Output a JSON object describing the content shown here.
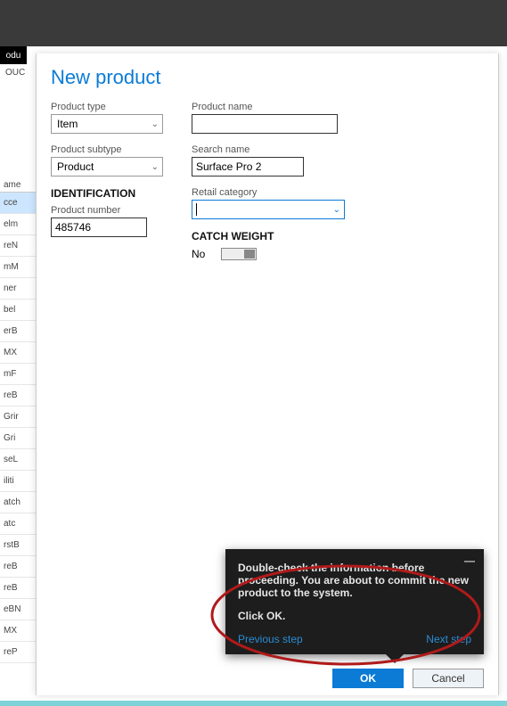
{
  "shell": {
    "tab_fragment": "odu",
    "ouc_fragment": "OUC"
  },
  "list_col": {
    "header": "ame",
    "items": [
      "cce",
      "elm",
      "reN",
      "mM",
      "ner",
      "bel",
      "erB",
      "MX",
      "mF",
      "reB",
      "Grir",
      "Gri",
      "seL",
      "iliti",
      "atch",
      "atc",
      "rstB",
      "reB",
      "reB",
      "eBN",
      "MX",
      "reP"
    ]
  },
  "panel": {
    "title": "New product",
    "product_type_label": "Product type",
    "product_type_value": "Item",
    "product_subtype_label": "Product subtype",
    "product_subtype_value": "Product",
    "product_name_label": "Product name",
    "product_name_value": "",
    "search_name_label": "Search name",
    "search_name_value": "Surface Pro 2",
    "retail_category_label": "Retail category",
    "retail_category_value": "",
    "identification_head": "IDENTIFICATION",
    "product_number_label": "Product number",
    "product_number_value": "485746",
    "catch_weight_head": "CATCH WEIGHT",
    "catch_weight_value": "No"
  },
  "footer": {
    "ok_label": "OK",
    "cancel_label": "Cancel"
  },
  "tooltip": {
    "line1": "Double-check the information before proceeding. You are about to commit the new product to the system.",
    "line2": "Click OK.",
    "prev": "Previous step",
    "next": "Next step"
  }
}
